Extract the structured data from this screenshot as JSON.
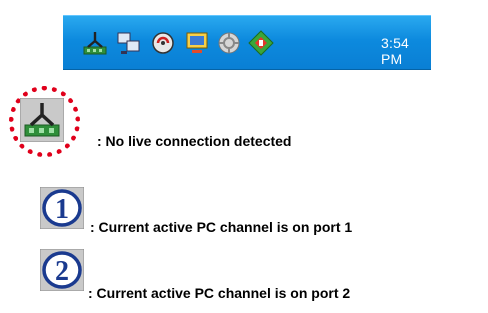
{
  "taskbar": {
    "clock": "3:54 PM",
    "tray_icons": [
      "kvm-no-connection-icon",
      "network-icon",
      "volume-icon",
      "display-icon",
      "update-icon",
      "security-icon"
    ]
  },
  "legend": [
    {
      "icon": "kvm-no-connection-icon",
      "text": ": No live connection detected"
    },
    {
      "icon": "port-1-icon",
      "text": ": Current active PC channel is on port 1"
    },
    {
      "icon": "port-2-icon",
      "text": ": Current active PC channel is on port 2"
    }
  ],
  "colors": {
    "taskbar": "#0d8ade",
    "highlight": "#e0001b"
  }
}
